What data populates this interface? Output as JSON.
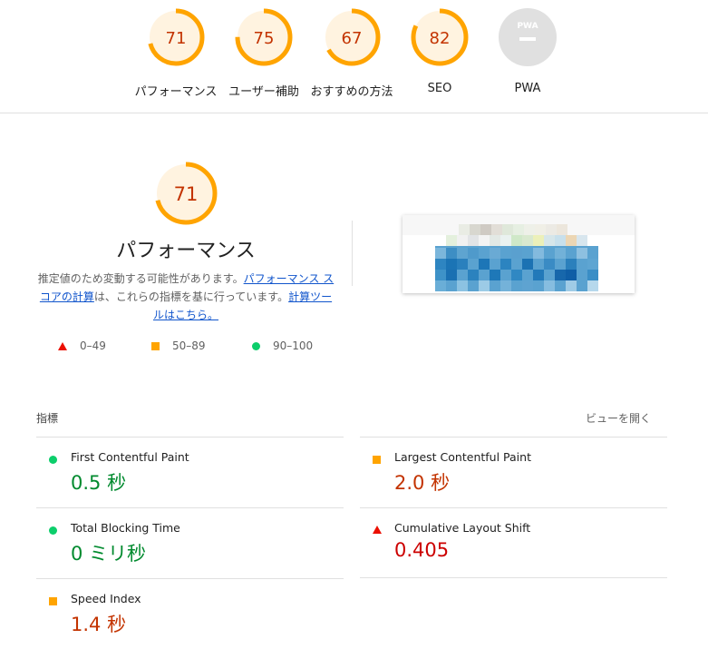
{
  "summary": [
    {
      "score": "71",
      "label": "パフォーマンス",
      "value": 71
    },
    {
      "score": "75",
      "label": "ユーザー補助",
      "value": 75
    },
    {
      "score": "67",
      "label": "おすすめの方法",
      "value": 67
    },
    {
      "score": "82",
      "label": "SEO",
      "value": 82
    },
    {
      "score": "PWA",
      "label": "PWA",
      "value": null
    }
  ],
  "performance": {
    "score": "71",
    "value": 71,
    "title": "パフォーマンス",
    "desc_prefix": "推定値のため変動する可能性があります。",
    "link1": "パフォーマンス スコアの計算",
    "desc_mid": "は、これらの指標を基に行っています。",
    "link2": "計算ツールはこちら。"
  },
  "legend": [
    {
      "range": "0–49",
      "shape": "triangle",
      "color": "#eb0f00"
    },
    {
      "range": "50–89",
      "shape": "square",
      "color": "#ffa400"
    },
    {
      "range": "90–100",
      "shape": "circle",
      "color": "#0cce6b"
    }
  ],
  "metrics_header": {
    "title": "指標",
    "toggle": "ビューを開く"
  },
  "metrics": [
    {
      "label": "First Contentful Paint",
      "value": "0.5 秒",
      "status": "pass"
    },
    {
      "label": "Largest Contentful Paint",
      "value": "2.0 秒",
      "status": "average"
    },
    {
      "label": "Total Blocking Time",
      "value": "0 ミリ秒",
      "status": "pass"
    },
    {
      "label": "Cumulative Layout Shift",
      "value": "0.405",
      "status": "fail"
    },
    {
      "label": "Speed Index",
      "value": "1.4 秒",
      "status": "average"
    }
  ],
  "colors": {
    "gauge_stroke": "#ffa400",
    "gauge_bg": "#fff3e0",
    "score_text": "#c33300",
    "link": "#1155cc"
  }
}
